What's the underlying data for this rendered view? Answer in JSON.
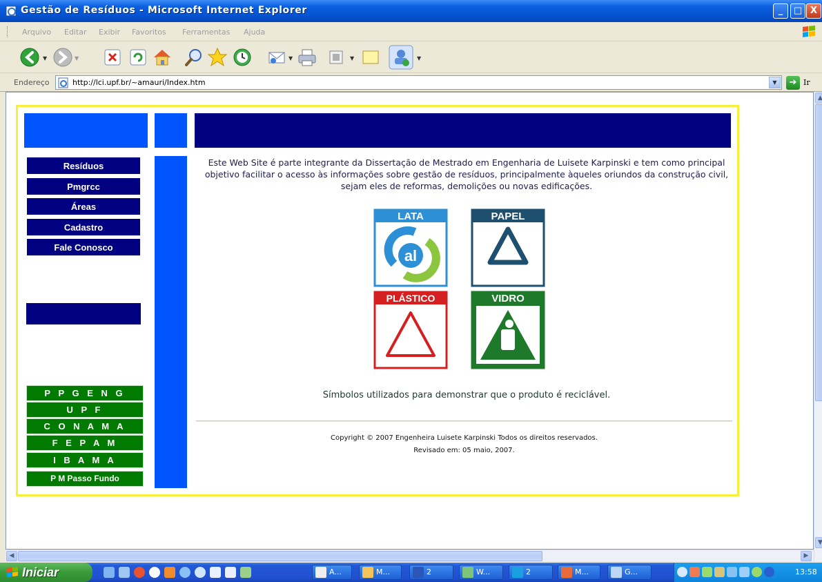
{
  "window": {
    "title": "Gestão de Resíduos - Microsoft Internet Explorer",
    "controls": {
      "minimize": "_",
      "maximize": "□",
      "close": "X"
    }
  },
  "menubar": {
    "items": [
      "Arquivo",
      "Editar",
      "Exibir",
      "Favoritos",
      "Ferramentas",
      "Ajuda"
    ]
  },
  "toolbar": {
    "icons": [
      "back-icon",
      "forward-icon",
      "stop-icon",
      "refresh-icon",
      "home-icon",
      "search-icon",
      "favorites-icon",
      "history-icon",
      "mail-icon",
      "print-icon",
      "edit-icon",
      "discuss-icon",
      "messenger-icon"
    ]
  },
  "addressbar": {
    "label": "Endereço",
    "url": "http://lci.upf.br/~amauri/Index.htm",
    "go_label": "Ir"
  },
  "page": {
    "nav": [
      "Resíduos",
      "Pmgrcc",
      "Áreas",
      "Cadastro",
      "Fale Conosco"
    ],
    "links": [
      "P P G E N G",
      "U P F",
      "C O N A M A",
      "F E P A M",
      "I B A M A",
      "P M Passo Fundo"
    ],
    "intro": "Este Web Site é parte integrante da Dissertação de Mestrado em Engenharia de Luisete Karpinski e tem como principal objetivo facilitar o acesso às informações sobre gestão de resíduos, principalmente àqueles oriundos da construção civil, sejam eles de reformas, demolições ou novas edificações.",
    "symbols": [
      {
        "label": "LATA",
        "sublabel": "al",
        "color": "#1a8ad4"
      },
      {
        "label": "PAPEL",
        "color": "#1e4f6e"
      },
      {
        "label": "PLÁSTICO",
        "color": "#d42020"
      },
      {
        "label": "VIDRO",
        "color": "#1e7a2a"
      }
    ],
    "caption": "Símbolos utilizados para demonstrar que o produto é reciclável.",
    "copyright": "Copyright © 2007 Engenheira Luisete Karpinski Todos os direitos reservados.",
    "revised": "Revisado em: 05 maio, 2007."
  },
  "taskbar": {
    "start_label": "Iniciar",
    "tasks": [
      "A...",
      "M...",
      "2",
      "W...",
      "2",
      "M...",
      "G..."
    ],
    "clock": "13:58"
  },
  "colors": {
    "navy": "#000080",
    "blue": "#0055ff",
    "green": "#007a00",
    "frame": "#f7ef3a"
  }
}
